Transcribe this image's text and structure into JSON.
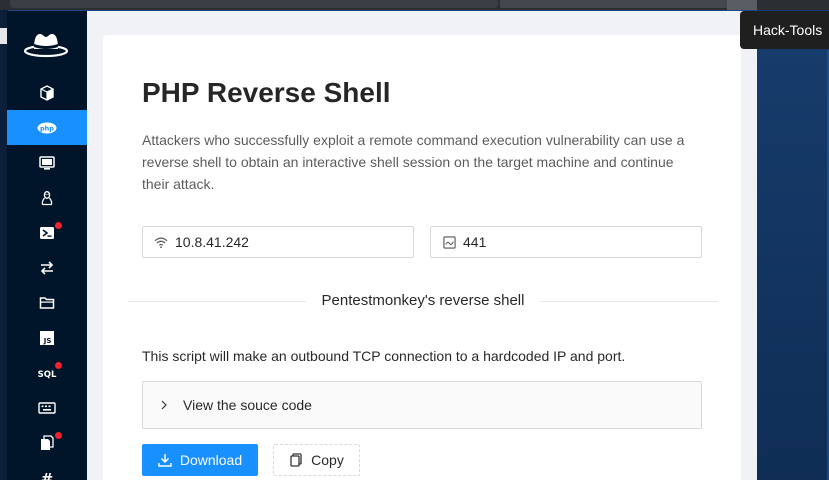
{
  "tooltip": {
    "text": "Hack-Tools"
  },
  "app": {
    "logo_icon": "hat-logo-icon",
    "colors": {
      "sidebar": "#001529",
      "active": "#1890ff",
      "badge": "#f5222d"
    }
  },
  "sidebar": {
    "items": [
      {
        "icon": "box-icon",
        "active": false,
        "badge": false
      },
      {
        "icon": "php-icon",
        "active": true,
        "badge": false
      },
      {
        "icon": "desktop-icon",
        "active": false,
        "badge": false
      },
      {
        "icon": "linux-icon",
        "active": false,
        "badge": false
      },
      {
        "icon": "powershell-icon",
        "active": false,
        "badge": true
      },
      {
        "icon": "transfer-icon",
        "active": false,
        "badge": false
      },
      {
        "icon": "folder-icon",
        "active": false,
        "badge": false
      },
      {
        "icon": "js-icon",
        "active": false,
        "badge": false
      },
      {
        "icon": "sql-icon",
        "active": false,
        "badge": true
      },
      {
        "icon": "keyboard-icon",
        "active": false,
        "badge": false
      },
      {
        "icon": "file-copy-icon",
        "active": false,
        "badge": true
      },
      {
        "icon": "hash-icon",
        "active": false,
        "badge": false
      }
    ],
    "php_label": "php",
    "js_label": "JS",
    "sql_label": "SQL",
    "hash_label": "#"
  },
  "main": {
    "title": "PHP Reverse Shell",
    "description": "Attackers who successfully exploit a remote command execution vulnerability can use a reverse shell to obtain an interactive shell session on the target machine and continue their attack.",
    "ip": {
      "value": "10.8.41.242",
      "icon": "wifi-icon"
    },
    "port": {
      "value": "441",
      "icon": "port-icon"
    },
    "divider_title": "Pentestmonkey's reverse shell",
    "note": "This script will make an outbound TCP connection to a hardcoded IP and port.",
    "collapse_label": "View the souce code",
    "download_label": "Download",
    "copy_label": "Copy"
  }
}
